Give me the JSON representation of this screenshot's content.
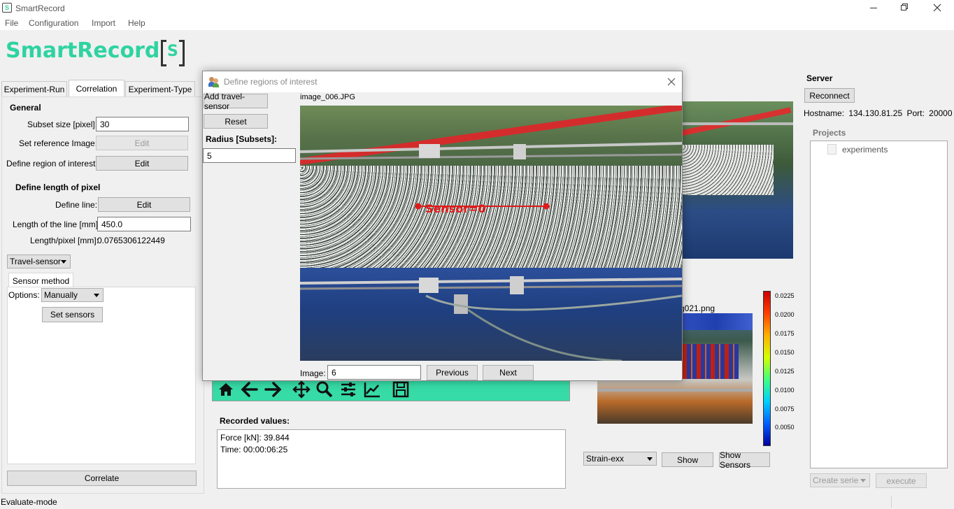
{
  "window": {
    "title": "SmartRecord"
  },
  "menu": [
    "File",
    "Configuration",
    "Import",
    "Help"
  ],
  "logo": {
    "text": "SmartRecord",
    "mark": "S"
  },
  "tabs": [
    "Experiment-Run",
    "Correlation",
    "Experiment-Type"
  ],
  "general": {
    "heading": "General",
    "subset_label": "Subset size [pixel]:",
    "subset_value": "30",
    "ref_label": "Set reference Image:",
    "ref_button": "Edit",
    "roi_label": "Define region of interest:",
    "roi_button": "Edit"
  },
  "pixel": {
    "heading": "Define length of pixel",
    "line_label": "Define line:",
    "line_button": "Edit",
    "length_label": "Length of the line [mm]:",
    "length_value": "450.0",
    "lp_label": "Length/pixel [mm]:",
    "lp_value": "0.0765306122449"
  },
  "sensor": {
    "type": "Travel-sensor",
    "tab": "Sensor method",
    "options_label": "Options:",
    "options_value": "Manually",
    "set_button": "Set sensors",
    "correlate": "Correlate"
  },
  "status": "Evaluate-mode",
  "recorded": {
    "heading": "Recorded values:",
    "lines": [
      "Force [kN]: 39.844",
      "Time: 00:00:06:25"
    ]
  },
  "right_panel": {
    "image_name_partial": "g021.png",
    "strain_select": "Strain-exx",
    "show": "Show",
    "show_sensors": "Show Sensors",
    "colorbar": {
      "ticks": [
        "0.0225",
        "0.0200",
        "0.0175",
        "0.0150",
        "0.0125",
        "0.0100",
        "0.0075",
        "0.0050"
      ],
      "colors": [
        "#cc0000",
        "#ff4000",
        "#ffb000",
        "#d4ff00",
        "#40ff80",
        "#00d0ff",
        "#0060ff",
        "#0000a0"
      ]
    }
  },
  "server": {
    "heading": "Server",
    "reconnect": "Reconnect",
    "hostname_label": "Hostname:",
    "hostname": "134.130.81.25",
    "port_label": "Port:",
    "port": "20000",
    "projects_heading": "Projects",
    "projects": [
      "experiments"
    ],
    "create_serie": "Create serie",
    "execute": "execute"
  },
  "dialog": {
    "title": "Define regions of interest",
    "add_sensor": "Add travel-sensor",
    "reset": "Reset",
    "radius_label": "Radius [Subsets]:",
    "radius_value": "5",
    "filename": "image_006.JPG",
    "sensor_label": "Sensor=0",
    "image_label": "Image:",
    "image_value": "6",
    "previous": "Previous",
    "next": "Next"
  },
  "colors": {
    "brand": "#2fd3a0",
    "toolbar": "#36dba6",
    "sensor": "#e01b1b"
  }
}
